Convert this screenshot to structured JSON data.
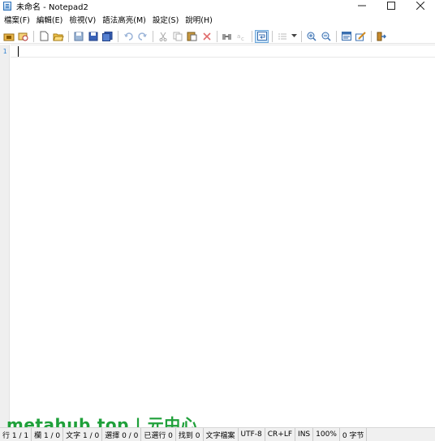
{
  "window": {
    "title": "未命名 - Notepad2",
    "minimize_glyph": "—",
    "maximize_glyph": "☐",
    "close_glyph": "✕"
  },
  "menu": {
    "items": [
      {
        "label": "檔案(F)"
      },
      {
        "label": "編輯(E)"
      },
      {
        "label": "檢視(V)"
      },
      {
        "label": "語法高亮(M)"
      },
      {
        "label": "設定(S)"
      },
      {
        "label": "說明(H)"
      }
    ]
  },
  "toolbar": {
    "buttons": [
      "open-recent-icon",
      "browse-icon",
      "new-file-icon",
      "open-folder-icon",
      "save-icon",
      "save-as-icon",
      "save-copy-icon",
      "undo-icon",
      "redo-icon",
      "cut-icon",
      "copy-icon",
      "paste-icon",
      "delete-icon",
      "find-icon",
      "replace-icon",
      "word-wrap-icon",
      "list-icon",
      "zoom-in-icon",
      "zoom-out-icon",
      "scheme-icon",
      "customize-icon",
      "exit-icon"
    ],
    "active": "word-wrap-icon"
  },
  "editor": {
    "line_numbers": [
      "1"
    ],
    "content": ""
  },
  "watermark": {
    "text": "metahub.top | 元中心"
  },
  "statusbar": {
    "cells": [
      {
        "text": "行 1 / 1"
      },
      {
        "text": "欄 1 / 0"
      },
      {
        "text": "文字 1 / 0"
      },
      {
        "text": "選擇 0 / 0"
      },
      {
        "text": "已選行 0"
      },
      {
        "text": "找到 0"
      },
      {
        "text": "文字檔案"
      },
      {
        "text": "UTF-8"
      },
      {
        "text": "CR+LF"
      },
      {
        "text": "INS"
      },
      {
        "text": "100%"
      },
      {
        "text": "0 字节"
      }
    ]
  },
  "colors": {
    "accent": "#2d7fd0",
    "watermark": "#1fa03a",
    "gutter": "#efefef",
    "statusbar": "#f0f0f0"
  }
}
